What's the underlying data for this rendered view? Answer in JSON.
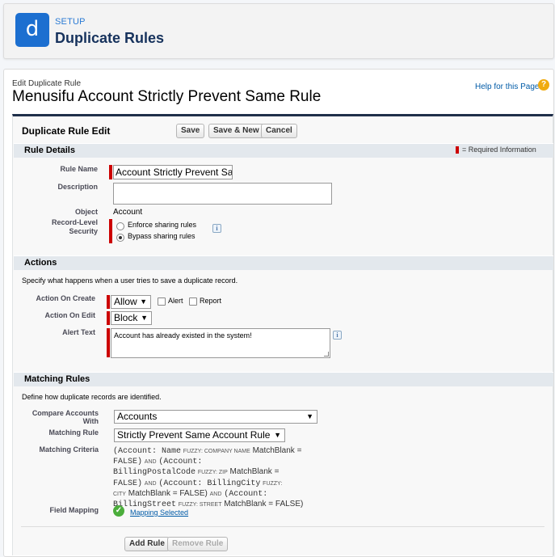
{
  "header": {
    "icon_letter": "d",
    "setup_label": "SETUP",
    "page_title": "Duplicate Rules",
    "accent_color": "#1c6fd0"
  },
  "page": {
    "edit_label": "Edit Duplicate Rule",
    "rule_title": "Menusifu Account Strictly Prevent Same Rule",
    "help_link": "Help for this Page",
    "help_icon": "?"
  },
  "block": {
    "title": "Duplicate Rule Edit",
    "buttons": {
      "save": "Save",
      "save_new": "Save & New",
      "cancel": "Cancel"
    }
  },
  "rule_details": {
    "title": "Rule Details",
    "required_legend": "= Required Information",
    "rule_name_label": "Rule Name",
    "rule_name_value": "Account Strictly Prevent Sa",
    "description_label": "Description",
    "description_value": "",
    "object_label": "Object",
    "object_value": "Account",
    "security_label": "Record-Level Security",
    "security_options": [
      "Enforce sharing rules",
      "Bypass sharing rules"
    ],
    "security_selected": "Bypass sharing rules"
  },
  "actions": {
    "title": "Actions",
    "description": "Specify what happens when a user tries to save a duplicate record.",
    "on_create_label": "Action On Create",
    "on_create_value": "Allow",
    "alert_label": "Alert",
    "report_label": "Report",
    "on_edit_label": "Action On Edit",
    "on_edit_value": "Block",
    "alert_text_label": "Alert Text",
    "alert_text_value": "Account has already existed in the system!"
  },
  "matching_rules": {
    "title": "Matching Rules",
    "description": "Define how duplicate records are identified.",
    "compare_label": "Compare Accounts With",
    "compare_value": "Accounts",
    "matching_rule_label": "Matching Rule",
    "matching_rule_value": "Strictly Prevent Same Account Rule",
    "criteria_label": "Matching Criteria",
    "criteria": {
      "c1": "(Account: Name",
      "c1_tag": "FUZZY: COMPANY NAME",
      "c1_tail": "MatchBlank =",
      "c2": "FALSE)",
      "and": "AND",
      "c2b": "(Account:",
      "c3": "BillingPostalCode",
      "c3_tag": "FUZZY: ZIP",
      "c3_tail": "MatchBlank =",
      "c4": "FALSE)",
      "c4b": "(Account: BillingCity",
      "c4_tag": "FUZZY:",
      "c5_tag": "CITY",
      "c5": "MatchBlank = FALSE)",
      "c5b": "(Account:",
      "c6": "BillingStreet",
      "c6_tag": "FUZZY: STREET",
      "c6_tail": "MatchBlank = FALSE)"
    },
    "field_mapping_label": "Field Mapping",
    "field_mapping_link": "Mapping Selected",
    "add_rule": "Add Rule",
    "remove_rule": "Remove Rule"
  }
}
